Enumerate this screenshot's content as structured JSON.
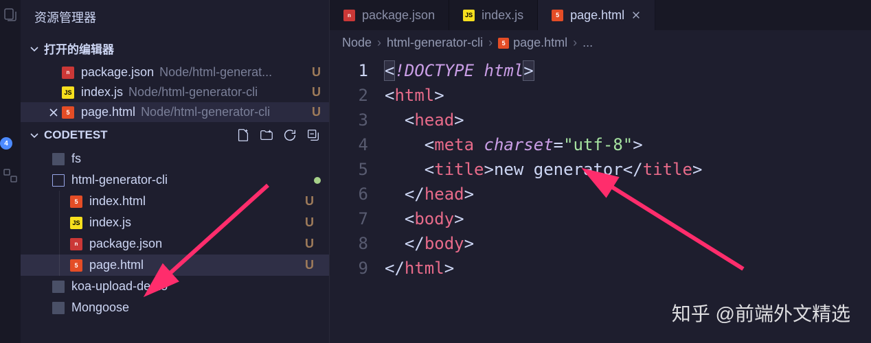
{
  "activity": {
    "badge": "4"
  },
  "sidebar": {
    "title": "资源管理器",
    "openEditors": {
      "label": "打开的编辑器",
      "items": [
        {
          "name": "package.json",
          "path": "Node/html-generat...",
          "status": "U",
          "icon": "npm",
          "active": false
        },
        {
          "name": "index.js",
          "path": "Node/html-generator-cli",
          "status": "U",
          "icon": "js",
          "active": false
        },
        {
          "name": "page.html",
          "path": "Node/html-generator-cli",
          "status": "U",
          "icon": "html",
          "active": true
        }
      ]
    },
    "workspace": {
      "label": "CODETEST",
      "tree": [
        {
          "name": "fs",
          "type": "folder",
          "indent": 0
        },
        {
          "name": "html-generator-cli",
          "type": "folder-open",
          "indent": 0,
          "modified": true
        },
        {
          "name": "index.html",
          "type": "html",
          "indent": 1,
          "status": "U"
        },
        {
          "name": "index.js",
          "type": "js",
          "indent": 1,
          "status": "U"
        },
        {
          "name": "package.json",
          "type": "npm",
          "indent": 1,
          "status": "U"
        },
        {
          "name": "page.html",
          "type": "html",
          "indent": 1,
          "status": "U",
          "selected": true
        },
        {
          "name": "koa-upload-demo",
          "type": "folder",
          "indent": 0
        },
        {
          "name": "Mongoose",
          "type": "folder",
          "indent": 0
        }
      ]
    }
  },
  "tabs": [
    {
      "label": "package.json",
      "icon": "npm",
      "active": false
    },
    {
      "label": "index.js",
      "icon": "js",
      "active": false
    },
    {
      "label": "page.html",
      "icon": "html",
      "active": true
    }
  ],
  "breadcrumb": {
    "items": [
      "Node",
      "html-generator-cli"
    ],
    "file": "page.html",
    "fileIcon": "html",
    "tail": "..."
  },
  "code": {
    "lines": 9,
    "l1_dt": "!DOCTYPE",
    "l1_ht": "html",
    "l2_tag": "html",
    "l3_tag": "head",
    "l4_tag": "meta",
    "l4_attr": "charset",
    "l4_val": "\"utf-8\"",
    "l5_tag": "title",
    "l5_txt": "new generator",
    "l6_tag": "head",
    "l7_tag": "body",
    "l8_tag": "body",
    "l9_tag": "html"
  },
  "watermark": "知乎 @前端外文精选"
}
